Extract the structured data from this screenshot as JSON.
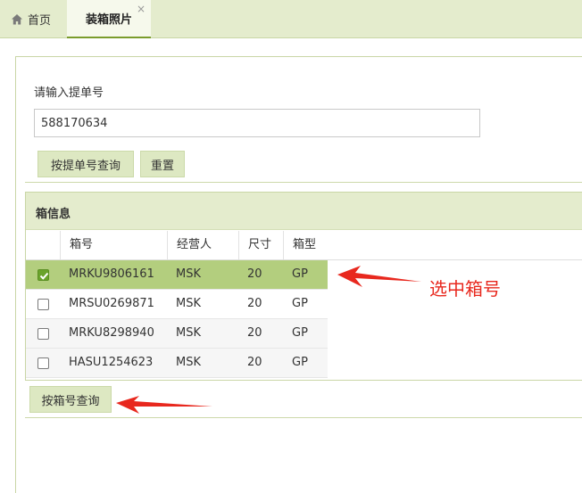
{
  "tabs": {
    "home_label": "首页",
    "active_label": "装箱照片",
    "close_symbol": "×"
  },
  "form": {
    "label": "请输入提单号",
    "bl_number_value": "588170634",
    "query_by_bl_label": "按提单号查询",
    "reset_label": "重置"
  },
  "box_section": {
    "title": "箱信息",
    "columns": [
      "箱号",
      "经营人",
      "尺寸",
      "箱型"
    ],
    "rows": [
      {
        "box_no": "MRKU9806161",
        "operator": "MSK",
        "size": "20",
        "type": "GP",
        "checked": true
      },
      {
        "box_no": "MRSU0269871",
        "operator": "MSK",
        "size": "20",
        "type": "GP",
        "checked": false
      },
      {
        "box_no": "MRKU8298940",
        "operator": "MSK",
        "size": "20",
        "type": "GP",
        "checked": false
      },
      {
        "box_no": "HASU1254623",
        "operator": "MSK",
        "size": "20",
        "type": "GP",
        "checked": false
      }
    ],
    "query_by_box_label": "按箱号查询"
  },
  "annotation": {
    "select_box_text": "选中箱号"
  },
  "colors": {
    "accent_green": "#7a9c2c",
    "header_bg": "#e4eccd",
    "selected_row": "#b3ce7e",
    "annotation_red": "#e8281e"
  }
}
